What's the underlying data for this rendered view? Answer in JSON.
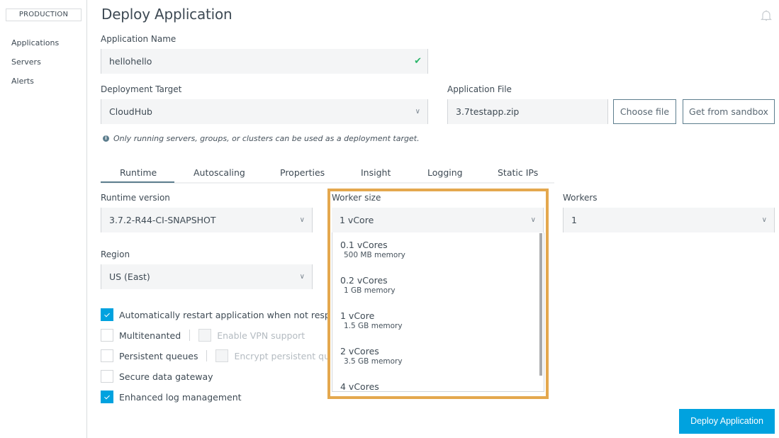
{
  "sidebar": {
    "environment": "PRODUCTION",
    "items": [
      {
        "label": "Applications"
      },
      {
        "label": "Servers"
      },
      {
        "label": "Alerts"
      }
    ]
  },
  "header": {
    "title": "Deploy Application",
    "notification_icon": "bell-icon"
  },
  "form": {
    "app_name": {
      "label": "Application Name",
      "value": "hellohello",
      "status_icon": "check-icon"
    },
    "deployment_target": {
      "label": "Deployment Target",
      "value": "CloudHub"
    },
    "app_file": {
      "label": "Application File",
      "value": "3.7testapp.zip"
    },
    "choose_file_label": "Choose file",
    "sandbox_label": "Get from sandbox",
    "hint": "Only running servers, groups, or clusters can be used as a deployment target."
  },
  "tabs": [
    {
      "label": "Runtime",
      "active": true
    },
    {
      "label": "Autoscaling"
    },
    {
      "label": "Properties"
    },
    {
      "label": "Insight"
    },
    {
      "label": "Logging"
    },
    {
      "label": "Static IPs"
    }
  ],
  "runtime": {
    "runtime_version": {
      "label": "Runtime version",
      "value": "3.7.2-R44-CI-SNAPSHOT"
    },
    "region": {
      "label": "Region",
      "value": "US (East)"
    },
    "worker_size": {
      "label": "Worker size",
      "value": "1 vCore",
      "options": [
        {
          "core": "0.1 vCores",
          "memory": "500 MB memory"
        },
        {
          "core": "0.2 vCores",
          "memory": "1 GB memory"
        },
        {
          "core": "1 vCore",
          "memory": "1.5 GB memory"
        },
        {
          "core": "2 vCores",
          "memory": "3.5 GB memory"
        },
        {
          "core": "4 vCores",
          "memory": ""
        }
      ]
    },
    "workers": {
      "label": "Workers",
      "value": "1"
    }
  },
  "options": {
    "auto_restart": {
      "label": "Automatically restart application when not respon",
      "checked": true
    },
    "multitenanted": {
      "label": "Multitenanted",
      "checked": false
    },
    "enable_vpn": {
      "label": "Enable VPN support",
      "checked": false,
      "disabled": true
    },
    "persistent_queues": {
      "label": "Persistent queues",
      "checked": false
    },
    "encrypt_queues": {
      "label": "Encrypt persistent que",
      "checked": false,
      "disabled": true
    },
    "secure_gateway": {
      "label": "Secure data gateway",
      "checked": false
    },
    "enhanced_log": {
      "label": "Enhanced log management",
      "checked": true
    }
  },
  "footer": {
    "deploy_label": "Deploy Application"
  },
  "colors": {
    "accent": "#00a2df",
    "highlight": "#e4a84e",
    "success": "#2bb56a",
    "tab_active": "#5d7e8e"
  }
}
